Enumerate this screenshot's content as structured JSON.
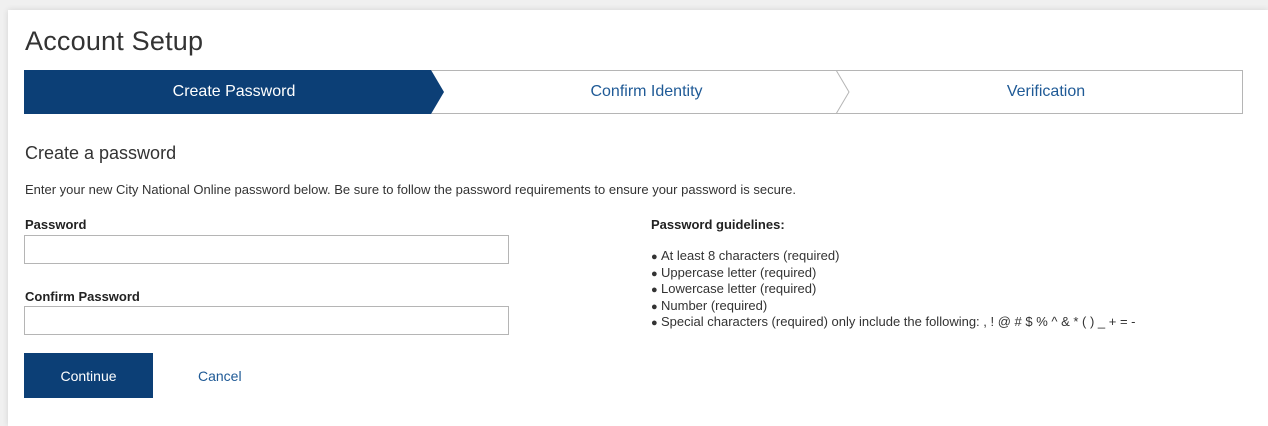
{
  "page": {
    "title": "Account Setup"
  },
  "stepper": {
    "active_color": "#0c3f76",
    "steps": [
      {
        "label": "Create Password",
        "state": "active"
      },
      {
        "label": "Confirm Identity",
        "state": "inactive"
      },
      {
        "label": "Verification",
        "state": "inactive"
      }
    ]
  },
  "form": {
    "section_title": "Create a password",
    "intro": "Enter your new City National Online password below. Be sure to follow the password requirements to ensure your password is secure.",
    "password_label": "Password",
    "password_value": "",
    "confirm_label": "Confirm Password",
    "confirm_value": "",
    "continue_label": "Continue",
    "cancel_label": "Cancel"
  },
  "guidelines": {
    "title": "Password guidelines:",
    "bullet_icon": "bullet-dot-icon",
    "items": [
      "At least 8 characters (required)",
      "Uppercase letter (required)",
      "Lowercase letter (required)",
      "Number (required)",
      "Special characters (required) only include the following: , ! @ # $ % ^ & * ( ) _ + = -"
    ]
  }
}
